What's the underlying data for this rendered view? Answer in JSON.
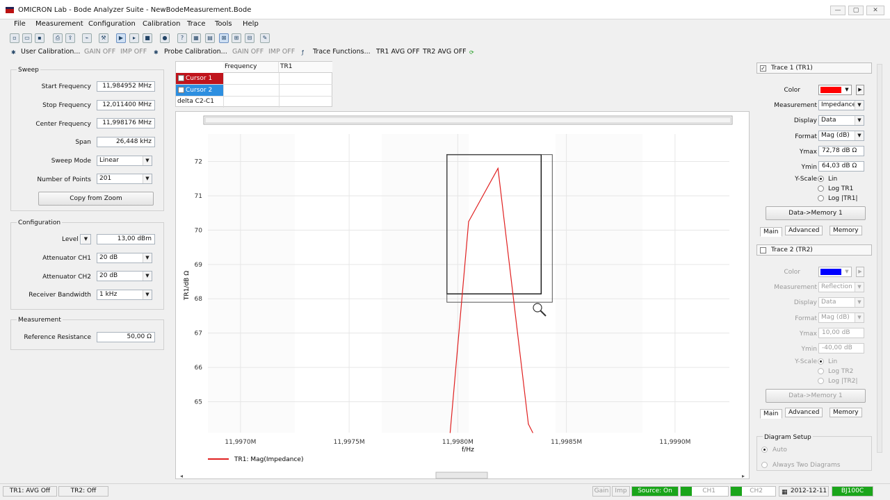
{
  "window": {
    "title": "OMICRON Lab - Bode Analyzer Suite - NewBodeMeasurement.Bode",
    "btn_min": "—",
    "btn_max": "▢",
    "btn_close": "✕"
  },
  "menu": [
    "File",
    "Measurement",
    "Configuration",
    "Calibration",
    "Trace",
    "Tools",
    "Help"
  ],
  "toolbar2": {
    "user_cal": "User Calibration...",
    "gain_off_1": "GAIN OFF",
    "imp_off_1": "IMP OFF",
    "probe_cal": "Probe Calibration...",
    "gain_off_2": "GAIN OFF",
    "imp_off_2": "IMP OFF",
    "trace_functions": "Trace Functions...",
    "tr1_avg": "TR1 AVG OFF",
    "tr2_avg": "TR2 AVG OFF"
  },
  "sweep": {
    "title": "Sweep",
    "start_label": "Start Frequency",
    "start_value": "11,984952 MHz",
    "stop_label": "Stop Frequency",
    "stop_value": "12,011400 MHz",
    "center_label": "Center Frequency",
    "center_value": "11,998176 MHz",
    "span_label": "Span",
    "span_value": "26,448 kHz",
    "mode_label": "Sweep Mode",
    "mode_value": "Linear",
    "points_label": "Number of Points",
    "points_value": "201",
    "copy_zoom": "Copy from Zoom"
  },
  "configuration": {
    "title": "Configuration",
    "level_label": "Level",
    "level_value": "13,00 dBm",
    "att1_label": "Attenuator CH1",
    "att1_value": "20 dB",
    "att2_label": "Attenuator CH2",
    "att2_value": "20 dB",
    "rbw_label": "Receiver Bandwidth",
    "rbw_value": "1 kHz"
  },
  "measurement": {
    "title": "Measurement",
    "ref_label": "Reference Resistance",
    "ref_value": "50,00 Ω"
  },
  "cursor_table": {
    "headers": [
      "Frequency",
      "TR1"
    ],
    "rows": [
      "Cursor 1",
      "Cursor 2",
      "delta C2-C1"
    ]
  },
  "chart_data": {
    "type": "line",
    "xlabel": "f/Hz",
    "ylabel": "TR1/dB Ω",
    "x_ticks": [
      "11,9970M",
      "11,9975M",
      "11,9980M",
      "11,9985M",
      "11,9990M"
    ],
    "y_ticks": [
      "72",
      "71",
      "70",
      "69",
      "68",
      "67",
      "66",
      "65"
    ],
    "xlim": [
      11.99685,
      11.99925
    ],
    "ylim": [
      64.1,
      72.8
    ],
    "grid": true,
    "legend_position": "bottom-left",
    "series": [
      {
        "name": "TR1: Mag(Impedance)",
        "color": "#e02020",
        "x": [
          11.997965,
          11.99805,
          11.998185,
          11.998325,
          11.998345
        ],
        "y": [
          64.1,
          70.25,
          71.8,
          64.35,
          64.1
        ]
      }
    ],
    "zoom_box": {
      "x0": 11.99795,
      "x1": 11.998435,
      "y0": 67.9,
      "y1": 72.2
    }
  },
  "trace1": {
    "title": "Trace 1 (TR1)",
    "color_label": "Color",
    "color_value": "#ff0000",
    "measurement_label": "Measurement",
    "measurement_value": "Impedance",
    "display_label": "Display",
    "display_value": "Data",
    "format_label": "Format",
    "format_value": "Mag (dB)",
    "ymax_label": "Ymax",
    "ymax_value": "72,78 dB Ω",
    "ymin_label": "Ymin",
    "ymin_value": "64,03 dB Ω",
    "yscale_label": "Y-Scale",
    "opt_lin": "Lin",
    "opt_log": "Log TR1",
    "opt_logabs": "Log |TR1|",
    "data_memory": "Data->Memory 1",
    "tabs": [
      "Main",
      "Advanced",
      "Memory"
    ]
  },
  "trace2": {
    "title": "Trace 2 (TR2)",
    "color_label": "Color",
    "color_value": "#0000ff",
    "measurement_label": "Measurement",
    "measurement_value": "Reflection",
    "display_label": "Display",
    "display_value": "Data",
    "format_label": "Format",
    "format_value": "Mag (dB)",
    "ymax_label": "Ymax",
    "ymax_value": "10,00 dB",
    "ymin_label": "Ymin",
    "ymin_value": "-40,00 dB",
    "yscale_label": "Y-Scale",
    "opt_lin": "Lin",
    "opt_log": "Log TR2",
    "opt_logabs": "Log |TR2|",
    "data_memory": "Data->Memory 1",
    "tabs": [
      "Main",
      "Advanced",
      "Memory"
    ]
  },
  "diagram_setup": {
    "title": "Diagram Setup",
    "auto": "Auto",
    "two": "Always Two Diagrams"
  },
  "status": {
    "tr1": "TR1:  AVG Off",
    "tr2": "TR2:  Off",
    "gain": "Gain",
    "imp": "Imp",
    "source": "Source: On",
    "ch1": "CH1",
    "ch2": "CH2",
    "date": "2012-12-11",
    "device": "BJ100C"
  }
}
